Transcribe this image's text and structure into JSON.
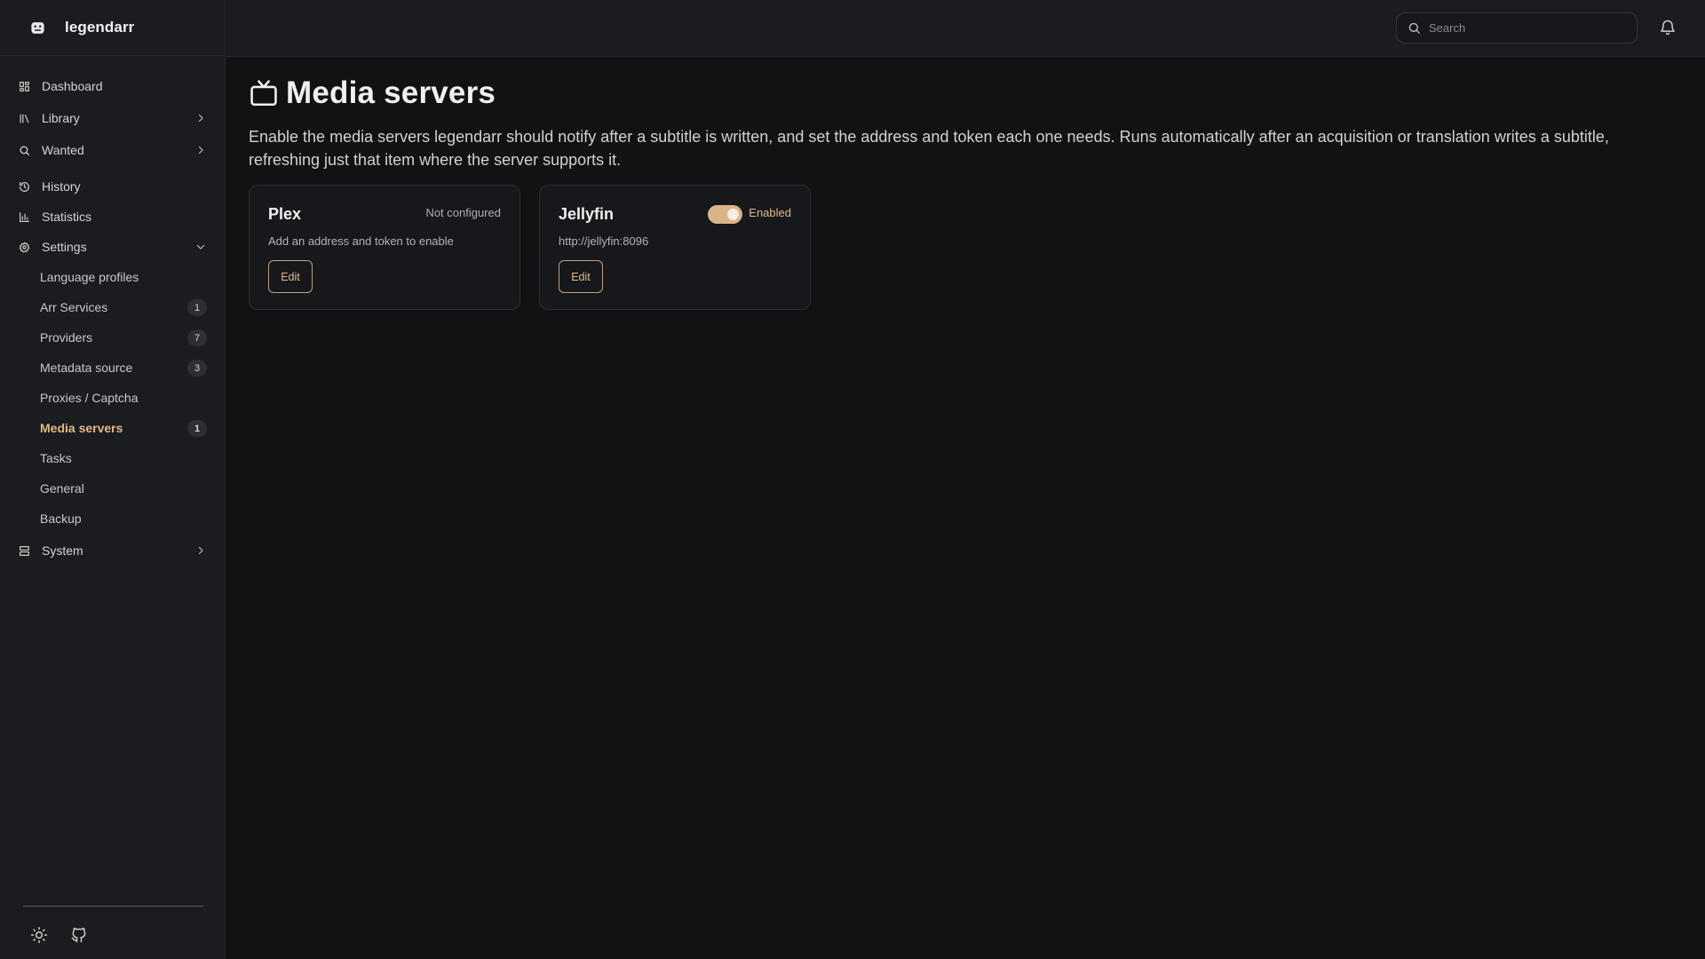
{
  "app": {
    "name": "legendarr"
  },
  "search": {
    "placeholder": "Search"
  },
  "nav": {
    "dashboard": "Dashboard",
    "library": "Library",
    "wanted": "Wanted",
    "history": "History",
    "statistics": "Statistics",
    "settings": "Settings",
    "system": "System",
    "settings_items": [
      {
        "label": "Language profiles",
        "badge": null
      },
      {
        "label": "Arr Services",
        "badge": "1"
      },
      {
        "label": "Providers",
        "badge": "7"
      },
      {
        "label": "Metadata source",
        "badge": "3"
      },
      {
        "label": "Proxies / Captcha",
        "badge": null
      },
      {
        "label": "Media servers",
        "badge": "1",
        "active": true
      },
      {
        "label": "Tasks",
        "badge": null
      },
      {
        "label": "General",
        "badge": null
      },
      {
        "label": "Backup",
        "badge": null
      }
    ]
  },
  "page": {
    "title": "Media servers",
    "description": "Enable the media servers legendarr should notify after a subtitle is written, and set the address and token each one needs. Runs automatically after an acquisition or translation writes a subtitle, refreshing just that item where the server supports it."
  },
  "servers": [
    {
      "name": "Plex",
      "status": "Not configured",
      "detail": "Add an address and token to enable",
      "edit_label": "Edit",
      "enabled": false
    },
    {
      "name": "Jellyfin",
      "status": "Enabled",
      "detail": "http://jellyfin:8096",
      "edit_label": "Edit",
      "enabled": true
    }
  ],
  "colors": {
    "accent": "#e0b98a",
    "background": "#111214",
    "sidebar": "#1b1c1f"
  },
  "icons": {
    "brand": "robot-icon",
    "dashboard": "grid-icon",
    "library": "library-icon",
    "wanted": "search-icon",
    "history": "history-icon",
    "statistics": "bar-chart-icon",
    "settings": "gear-icon",
    "system": "server-icon",
    "page": "tv-icon",
    "notifications": "bell-icon",
    "theme": "sun-icon",
    "github": "github-icon"
  }
}
